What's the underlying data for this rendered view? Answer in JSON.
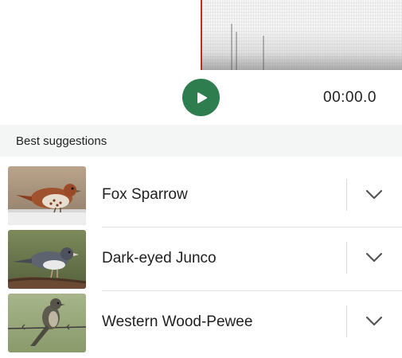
{
  "player": {
    "time": "00:00.0",
    "play_icon": "play-icon"
  },
  "suggestions": {
    "header": "Best suggestions",
    "items": [
      {
        "name": "Fox Sparrow",
        "expand_icon": "chevron-down-icon"
      },
      {
        "name": "Dark-eyed Junco",
        "expand_icon": "chevron-down-icon"
      },
      {
        "name": "Western Wood-Pewee",
        "expand_icon": "chevron-down-icon"
      }
    ]
  },
  "colors": {
    "accent": "#2e7d4f",
    "playhead": "#c62828",
    "header_bg": "#f4f6f5"
  }
}
